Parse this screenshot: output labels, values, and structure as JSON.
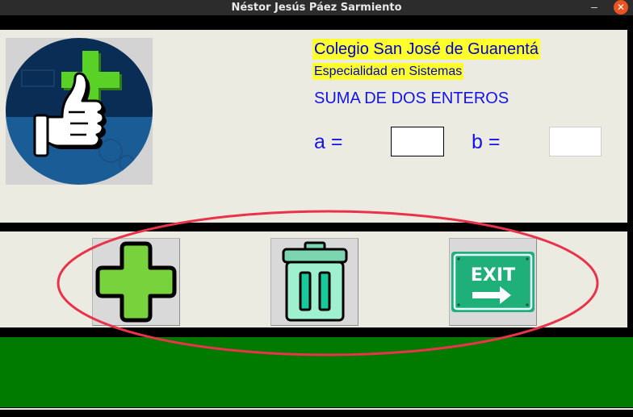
{
  "window": {
    "title": "Néstor Jesús Páez Sarmiento",
    "minimize_glyph": "–",
    "close_glyph": "✕"
  },
  "header": {
    "school": "Colegio San José de Guanentá",
    "specialty": "Especialidad en Sistemas",
    "heading": "SUMA DE DOS ENTEROS"
  },
  "form": {
    "a_label": "a =",
    "a_value": "",
    "b_label": "b =",
    "b_value": ""
  },
  "logo": {
    "icon": "thumbs-up-plus-icon"
  },
  "buttons": {
    "add_icon": "plus-icon",
    "clear_icon": "trash-icon",
    "exit_icon": "exit-sign-icon",
    "exit_text": "EXIT"
  },
  "colors": {
    "panel": "#ecebe1",
    "text_blue": "#1414e6",
    "highlight": "#ffff2b",
    "green_band": "#007b00",
    "annotation": "#e8334a"
  }
}
